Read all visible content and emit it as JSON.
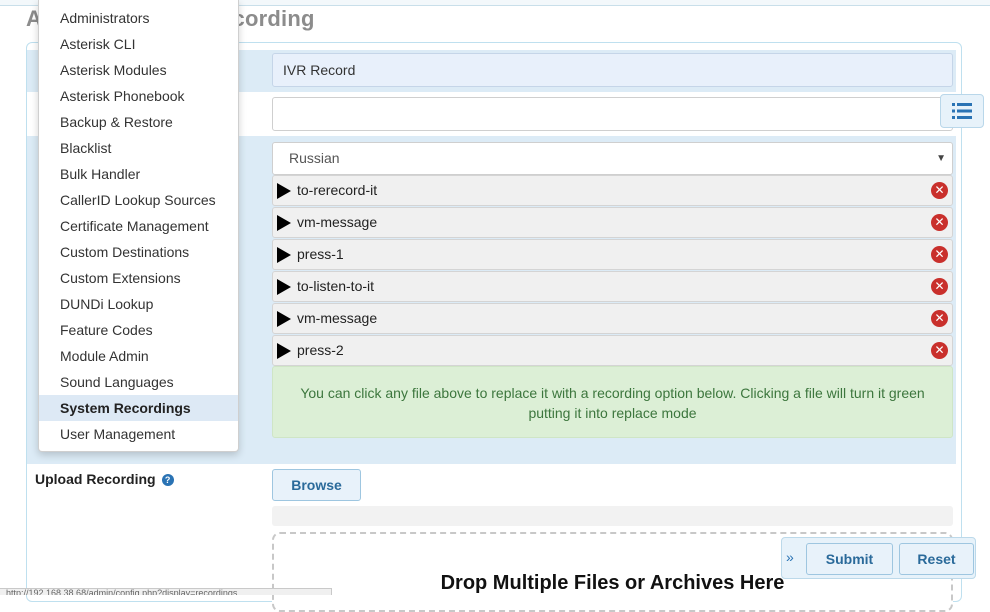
{
  "page": {
    "title": "Add New System Recording",
    "title_visible_prefix": "A",
    "title_visible_suffix": "ecording"
  },
  "dropdown_menu": {
    "items": [
      "Administrators",
      "Asterisk CLI",
      "Asterisk Modules",
      "Asterisk Phonebook",
      "Backup & Restore",
      "Blacklist",
      "Bulk Handler",
      "CallerID Lookup Sources",
      "Certificate Management",
      "Custom Destinations",
      "Custom Extensions",
      "DUNDi Lookup",
      "Feature Codes",
      "Module Admin",
      "Sound Languages",
      "System Recordings",
      "User Management"
    ],
    "active": "System Recordings"
  },
  "form": {
    "name": {
      "value": "IVR Record"
    },
    "description": {
      "value": ""
    },
    "language": {
      "selected": "Russian"
    },
    "files": [
      "to-rerecord-it",
      "vm-message",
      "press-1",
      "to-listen-to-it",
      "vm-message",
      "press-2"
    ],
    "files_hint": "You can click any file above to replace it with a recording option below. Clicking a file will turn it green putting it into replace mode",
    "upload": {
      "label": "Upload Recording",
      "browse_label": "Browse",
      "drop_text": "Drop Multiple Files or Archives Here"
    }
  },
  "actions": {
    "submit_label": "Submit",
    "reset_label": "Reset"
  },
  "statusbar": {
    "url": "http://192.168.38.68/admin/config.php?display=recordings"
  },
  "colors": {
    "accent": "#2a73b4",
    "band": "#dcebf6",
    "success_bg": "#dcefd6",
    "success_text": "#3c763d",
    "remove": "#c9302c"
  },
  "icons": {
    "list": "list-icon",
    "help": "question-circle-icon",
    "play": "play-icon",
    "remove": "remove-circle-icon",
    "chevron": "double-chevron-right-icon"
  }
}
